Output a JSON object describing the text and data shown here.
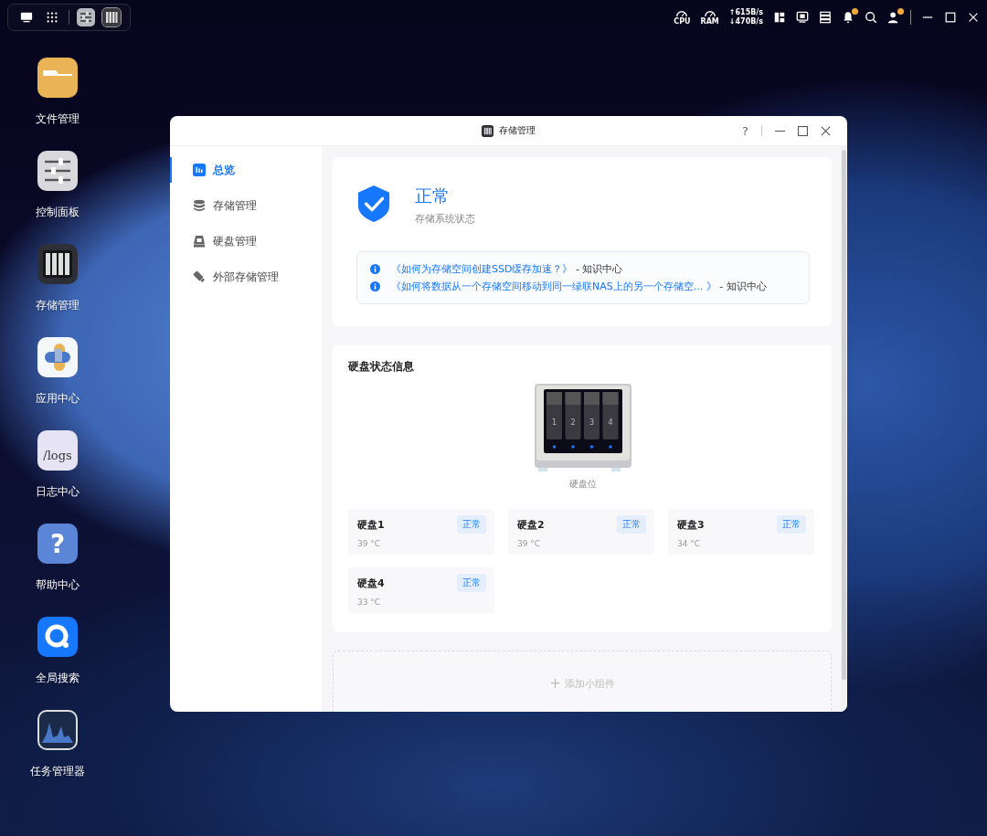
{
  "taskbar": {
    "apps": [
      {
        "kind": "control",
        "selected": false
      },
      {
        "kind": "storage",
        "selected": true
      }
    ],
    "cpu_label": "CPU",
    "ram_label": "RAM",
    "upload": "↑615B/s",
    "download": "↓470B/s",
    "notifications_dot": true,
    "user_dot": true
  },
  "desktop_icons": [
    {
      "kind": "folder",
      "label": "文件管理"
    },
    {
      "kind": "control",
      "label": "控制面板"
    },
    {
      "kind": "storage",
      "label": "存储管理"
    },
    {
      "kind": "apps",
      "label": "应用中心"
    },
    {
      "kind": "logs",
      "label": "日志中心",
      "icon_text": "/logs"
    },
    {
      "kind": "help",
      "label": "帮助中心",
      "icon_text": "?"
    },
    {
      "kind": "search",
      "label": "全局搜索"
    },
    {
      "kind": "monitor",
      "label": "任务管理器"
    }
  ],
  "window": {
    "title": "存储管理",
    "help": "?",
    "sidebar": {
      "items": [
        {
          "kind": "overview",
          "label": "总览",
          "selected": true
        },
        {
          "kind": "storage",
          "label": "存储管理",
          "selected": false
        },
        {
          "kind": "disk",
          "label": "硬盘管理",
          "selected": false
        },
        {
          "kind": "external",
          "label": "外部存储管理",
          "selected": false
        }
      ]
    },
    "status": {
      "title": "正常",
      "subtitle": "存储系统状态",
      "links": [
        {
          "text": "《如何为存储空间创建SSD缓存加速？》",
          "source": " - 知识中心"
        },
        {
          "text": "《如何将数据从一个存储空间移动到同一绿联NAS上的另一个存储空...  》",
          "source": " - 知识中心"
        }
      ]
    },
    "disk_info": {
      "title": "硬盘状态信息",
      "bays": [
        "1",
        "2",
        "3",
        "4"
      ],
      "caption": "硬盘位",
      "disks": [
        {
          "name": "硬盘1",
          "status": "正常",
          "temp": "39 °C"
        },
        {
          "name": "硬盘2",
          "status": "正常",
          "temp": "39 °C"
        },
        {
          "name": "硬盘3",
          "status": "正常",
          "temp": "34 °C"
        },
        {
          "name": "硬盘4",
          "status": "正常",
          "temp": "33 °C"
        }
      ]
    },
    "add_widget": {
      "plus": "+",
      "label": "添加小组件"
    }
  }
}
